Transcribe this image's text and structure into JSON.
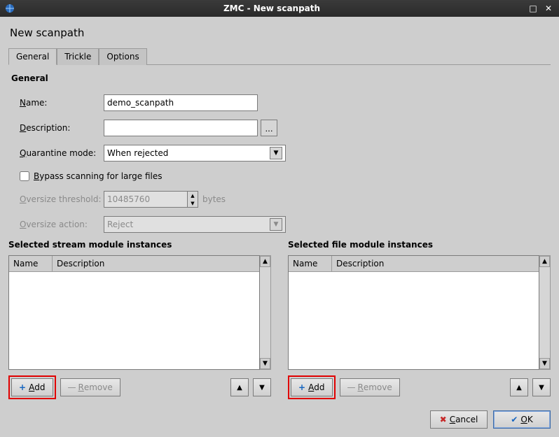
{
  "window": {
    "title": "ZMC - New scanpath"
  },
  "dialog_title": "New scanpath",
  "tabs": {
    "general": "General",
    "trickle": "Trickle",
    "options": "Options"
  },
  "general": {
    "section": "General",
    "name_label": "Name:",
    "name_value": "demo_scanpath",
    "desc_label": "Description:",
    "desc_value": "",
    "browse": "...",
    "qmode_label": "Quarantine mode:",
    "qmode_value": "When rejected",
    "bypass_label": "Bypass scanning for large files",
    "oversize_threshold_label": "Oversize threshold:",
    "oversize_threshold_value": "10485760",
    "oversize_threshold_unit": "bytes",
    "oversize_action_label": "Oversize action:",
    "oversize_action_value": "Reject"
  },
  "stream": {
    "title": "Selected stream module instances",
    "cols": {
      "name": "Name",
      "desc": "Description"
    },
    "add": "Add",
    "remove": "Remove"
  },
  "file": {
    "title": "Selected file module instances",
    "cols": {
      "name": "Name",
      "desc": "Description"
    },
    "add": "Add",
    "remove": "Remove"
  },
  "footer": {
    "cancel": "Cancel",
    "ok": "OK"
  }
}
